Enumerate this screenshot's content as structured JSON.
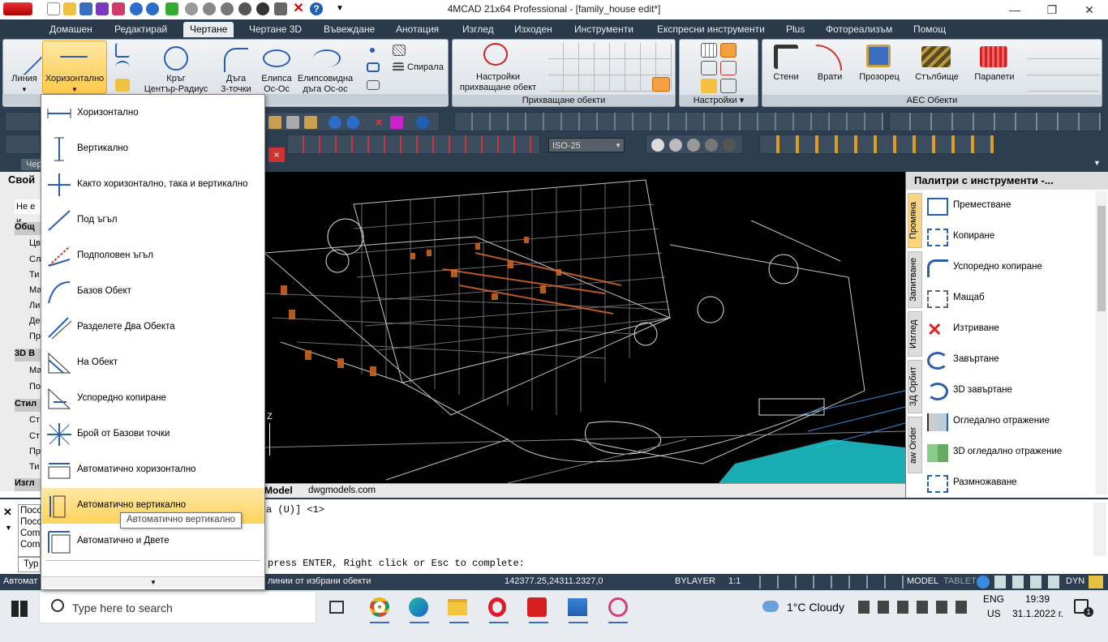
{
  "window": {
    "title": "4MCAD 21x64 Professional - [family_house edit*]",
    "minimize": "—",
    "restore": "❐",
    "close": "✕"
  },
  "menu_tabs": [
    "Домашен",
    "Редактирай",
    "Чертане",
    "Чертане 3D",
    "Въвеждане",
    "Анотация",
    "Изглед",
    "Изходен",
    "Инструменти",
    "Експресни инструменти",
    "Plus",
    "Фотореализъм",
    "Помощ"
  ],
  "active_tab": "Чертане",
  "ribbon": {
    "line": "Линия",
    "horizontal": "Хоризонтално",
    "circle": "Кръг",
    "circle_sub": "Център-Радиус",
    "arc": "Дъга",
    "arc_sub": "3-точки",
    "ellipse": "Елипса",
    "ellipse_sub": "Ос-Ос",
    "ellipse_arc": "Елипсовидна",
    "ellipse_arc_sub": "дъга Ос-ос",
    "spiral": "Спирала",
    "snap_settings_1": "Настройки",
    "snap_settings_2": "прихващане обект",
    "snap_panel": "Прихващане обекти",
    "settings_panel": "Настройки",
    "walls": "Стени",
    "doors": "Врати",
    "windows": "Прозорец",
    "stairs": "Стълбище",
    "parapets": "Парапети",
    "aec_panel": "AEC Обекти"
  },
  "toolbar": {
    "dimstyle": "ISO-25"
  },
  "drawing_tabs": {
    "current": "Черт"
  },
  "properties": {
    "title": "Свой",
    "selection": "Не е и",
    "general": "Общ",
    "rows": [
      "Цв",
      "Сл",
      "Ти",
      "Ма",
      "Ли",
      "Де",
      "Пр"
    ],
    "section_3d": "3D В",
    "rows_3d": [
      "Ма",
      "По"
    ],
    "section_style": "Стил",
    "rows_style": [
      "Ст",
      "Ст",
      "Пр",
      "Ти"
    ],
    "section_view": "Изгл"
  },
  "dropdown": {
    "items": [
      "Хоризонтално",
      "Вертикално",
      "Както хоризонтално, така и вертикално",
      "Под ъгъл",
      "Подполовен ъгъл",
      "Базов Обект",
      "Разделете Два Обекта",
      "На Обект",
      "Успоредно копиране",
      "Брой от Базови точки",
      "Автоматично хоризонтално",
      "Автоматично вертикално",
      "Автоматично и Двете"
    ],
    "highlighted_index": 11,
    "tooltip": "Автоматично вертикално",
    "close": "×"
  },
  "viewport": {
    "axis_z": "Z",
    "tabs": [
      "Model",
      "dwgmodels.com"
    ]
  },
  "palette": {
    "title": "Палитри с инструменти -...",
    "vtabs": [
      "Промяна",
      "Запитване",
      "Изглед",
      "3Д Орбит",
      "aw Order"
    ],
    "items": [
      "Преместване",
      "Копиране",
      "Успоредно копиране",
      "Мащаб",
      "Изтриване",
      "Завъртане",
      "3D завъртане",
      "Огледално отражение",
      "3D огледално отражение",
      "Размножаване"
    ]
  },
  "command": {
    "history": [
      "Посо",
      "Посо",
      "Comm",
      "Comm"
    ],
    "prompt_tail": "а (U)] <1>",
    "input_head": "Тур",
    "input_tail": "press ENTER, Right click or Esc to complete:"
  },
  "status": {
    "left": "Автомат",
    "hint": "линии от избрани обекти",
    "coords": "142377.25,24311.2327,0",
    "layer": "BYLAYER",
    "scale": "1:1",
    "model": "MODEL",
    "tablet": "TABLET",
    "dyn": "DYN"
  },
  "taskbar": {
    "search": "Type here to search",
    "weather": "1°C  Cloudy",
    "lang": "ENG",
    "region": "US",
    "time": "19:39",
    "date": "31.1.2022 г.",
    "notif": "1"
  }
}
